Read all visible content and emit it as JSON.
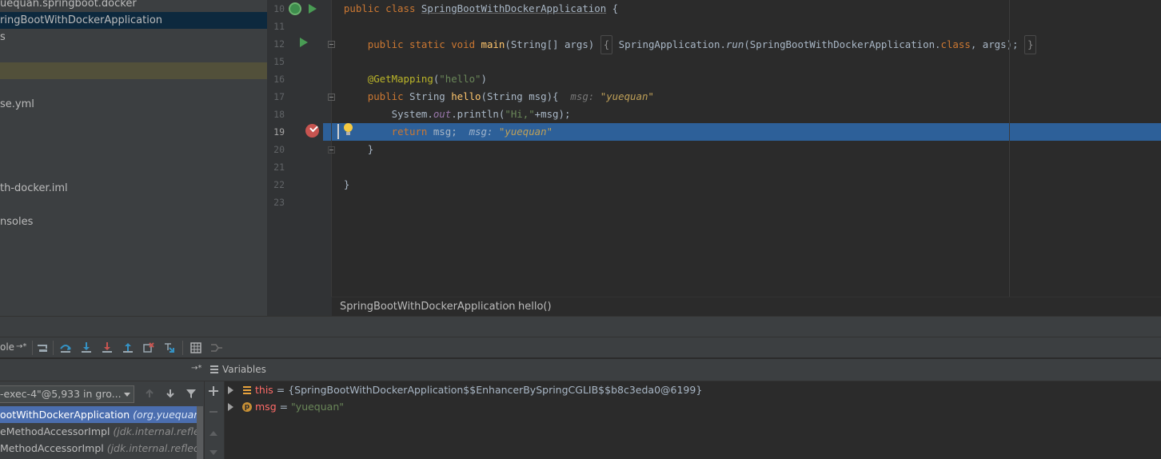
{
  "project_tree": [
    {
      "label": "uequan.springboot.docker",
      "state": "normal"
    },
    {
      "label": "ringBootWithDockerApplication",
      "state": "selected"
    },
    {
      "label": "s",
      "state": "normal"
    },
    {
      "label": "",
      "state": "normal"
    },
    {
      "label": "",
      "state": "highlight"
    },
    {
      "label": "",
      "state": "normal"
    },
    {
      "label": "se.yml",
      "state": "normal"
    },
    {
      "label": "",
      "state": "normal"
    },
    {
      "label": "",
      "state": "normal"
    },
    {
      "label": "",
      "state": "normal"
    },
    {
      "label": "",
      "state": "normal"
    },
    {
      "label": "th-docker.iml",
      "state": "normal"
    },
    {
      "label": "",
      "state": "normal"
    },
    {
      "label": "nsoles",
      "state": "normal"
    }
  ],
  "editor": {
    "line_numbers": [
      "10",
      "11",
      "12",
      "15",
      "16",
      "17",
      "18",
      "19",
      "20",
      "21",
      "22",
      "23"
    ],
    "current_line": "19",
    "line1": {
      "kw1": "public class ",
      "name": "SpringBootWithDockerApplication",
      "rest": " {"
    },
    "line3": {
      "indent": "    ",
      "kw": "public static void ",
      "fn": "main",
      "args": "(String[] args) ",
      "fold_open": "{",
      "body": " SpringApplication.",
      "run": "run",
      "call": "(SpringBootWithDockerApplication.",
      "cls_kw": "class",
      "tail": ", args); ",
      "fold_close": "}"
    },
    "line5": {
      "indent": "    ",
      "ann": "@GetMapping",
      "open": "(",
      "str": "\"hello\"",
      "close": ")"
    },
    "line6": {
      "indent": "    ",
      "kw": "public ",
      "type": "String ",
      "fn": "hello",
      "args": "(String msg){  ",
      "hint": "msg: ",
      "hint_val": "\"yuequan\""
    },
    "line7": {
      "indent": "        ",
      "obj": "System.",
      "out": "out",
      "call": ".println(",
      "str": "\"Hi,\"",
      "rest": "+msg);"
    },
    "line8": {
      "indent": "        ",
      "kw": "return ",
      "rest": "msg;  ",
      "hint": "msg: ",
      "hint_val": "\"yuequan\""
    },
    "line9": {
      "text": "    }"
    },
    "line11": {
      "text": "}"
    }
  },
  "breadcrumb": {
    "class": "SpringBootWithDockerApplication",
    "sep": "›",
    "method": "hello()"
  },
  "debug_toolbar": {
    "tab_label": "ole",
    "pin": "→*"
  },
  "frames": {
    "pin": "→*",
    "thread": "-exec-4\"@5,933 in gro...",
    "rows": [
      {
        "method": "ootWithDockerApplication",
        "pkg": " (org.yuequan.sp",
        "selected": true
      },
      {
        "method": "eMethodAccessorImpl",
        "pkg": " (jdk.internal.reflect)",
        "selected": false
      },
      {
        "method": "MethodAccessorImpl",
        "pkg": " (jdk.internal.reflect)",
        "selected": false
      }
    ]
  },
  "variables": {
    "header": "Variables",
    "rows": [
      {
        "name": "this",
        "eq": " = ",
        "value": "{SpringBootWithDockerApplication$$EnhancerBySpringCGLIB$$b8c3eda0@6199}",
        "icon": "this"
      },
      {
        "name": "msg",
        "eq": " = ",
        "value": "\"yuequan\"",
        "icon": "p"
      }
    ]
  },
  "colors": {
    "accent_blue": "#2d6099",
    "selection": "#4b6eaf",
    "breakpoint": "#c75450"
  }
}
